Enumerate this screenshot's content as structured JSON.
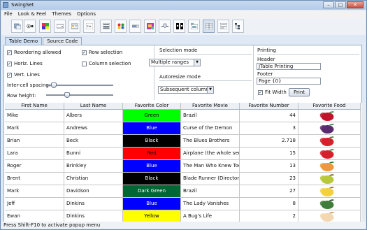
{
  "window": {
    "title": "SwingSet"
  },
  "menus": [
    "File",
    "Look & Feel",
    "Themes",
    "Options"
  ],
  "toolbar": {
    "icons": [
      "internal-frame-icon",
      "buttons-icon",
      "color-chooser-icon",
      "combobox-icon",
      "file-chooser-icon",
      "html-icon",
      "list-icon",
      "option-pane-icon",
      "progress-bar-icon",
      "scroll-pane-icon",
      "slider-icon",
      "split-pane-icon",
      "tabbed-pane-icon",
      "table-icon",
      "text-icon",
      "tree-icon"
    ],
    "selected": "table-icon"
  },
  "tabs": [
    {
      "label": "Table Demo",
      "selected": true
    },
    {
      "label": "Source Code",
      "selected": false
    }
  ],
  "controls": {
    "reordering_label": "Reordering allowed",
    "reordering": true,
    "row_selection_label": "Row selection",
    "row_selection": true,
    "horiz_lines_label": "Horiz. Lines",
    "horiz_lines": true,
    "column_selection_label": "Column selection",
    "column_selection": false,
    "vert_lines_label": "Vert. Lines",
    "vert_lines": true,
    "intercell_label": "Inter-cell spacing:",
    "intercell_value": 0.08,
    "row_height_label": "Row height:",
    "row_height_value": 0.3
  },
  "selection_mode": {
    "title": "Selection mode",
    "value": "Multiple ranges"
  },
  "autoresize_mode": {
    "title": "Autoresize mode",
    "value": "Subsequent columns"
  },
  "printing": {
    "title": "Printing",
    "header_label": "Header",
    "header_value": "JTable Printing",
    "footer_label": "Footer",
    "footer_value": "Page {0}",
    "fit_width_label": "Fit Width",
    "fit_width": true,
    "print_button": "Print"
  },
  "table": {
    "columns": [
      "First Name",
      "Last Name",
      "Favorite Color",
      "Favorite Movie",
      "Favorite Number",
      "Favorite Food"
    ],
    "rows": [
      {
        "first": "Mike",
        "last": "Albers",
        "color": "Green",
        "color_bg": "#00ff00",
        "color_fg": "#000000",
        "movie": "Brazil",
        "number": "44",
        "food": "cherries-icon"
      },
      {
        "first": "Mark",
        "last": "Andrews",
        "color": "Blue",
        "color_bg": "#0000ff",
        "color_fg": "#ffffff",
        "movie": "Curse of the Demon",
        "number": "3",
        "food": "grapes-icon"
      },
      {
        "first": "Brian",
        "last": "Beck",
        "color": "Black",
        "color_bg": "#000000",
        "color_fg": "#ffffff",
        "movie": "The Blues Brothers",
        "number": "2.718",
        "food": "strawberry-icon"
      },
      {
        "first": "Lara",
        "last": "Bunni",
        "color": "Red",
        "color_bg": "#ff0000",
        "color_fg": "#000000",
        "movie": "Airplane (the whole series)",
        "number": "15",
        "food": "strawberry-icon"
      },
      {
        "first": "Roger",
        "last": "Brinkley",
        "color": "Blue",
        "color_bg": "#0000ff",
        "color_fg": "#ffffff",
        "movie": "The Man Who Knew Too M...",
        "number": "13",
        "food": "peach-icon"
      },
      {
        "first": "Brent",
        "last": "Christian",
        "color": "Black",
        "color_bg": "#000000",
        "color_fg": "#ffffff",
        "movie": "Blade Runner (Director's ...",
        "number": "23",
        "food": "pear-icon"
      },
      {
        "first": "Mark",
        "last": "Davidson",
        "color": "Dark Green",
        "color_bg": "#006633",
        "color_fg": "#ffffff",
        "movie": "Brazil",
        "number": "27",
        "food": "banana-icon"
      },
      {
        "first": "Jeff",
        "last": "Dinkins",
        "color": "Blue",
        "color_bg": "#0000ff",
        "color_fg": "#ffffff",
        "movie": "The Lady Vanishes",
        "number": "8",
        "food": "pickle-icon"
      },
      {
        "first": "Ewan",
        "last": "Dinkins",
        "color": "Yellow",
        "color_bg": "#ffff00",
        "color_fg": "#000000",
        "movie": "A Bug's Life",
        "number": "2",
        "food": "ice-cream-icon"
      }
    ]
  },
  "status": {
    "text": "Press Shift-F10 to activate popup menu"
  }
}
